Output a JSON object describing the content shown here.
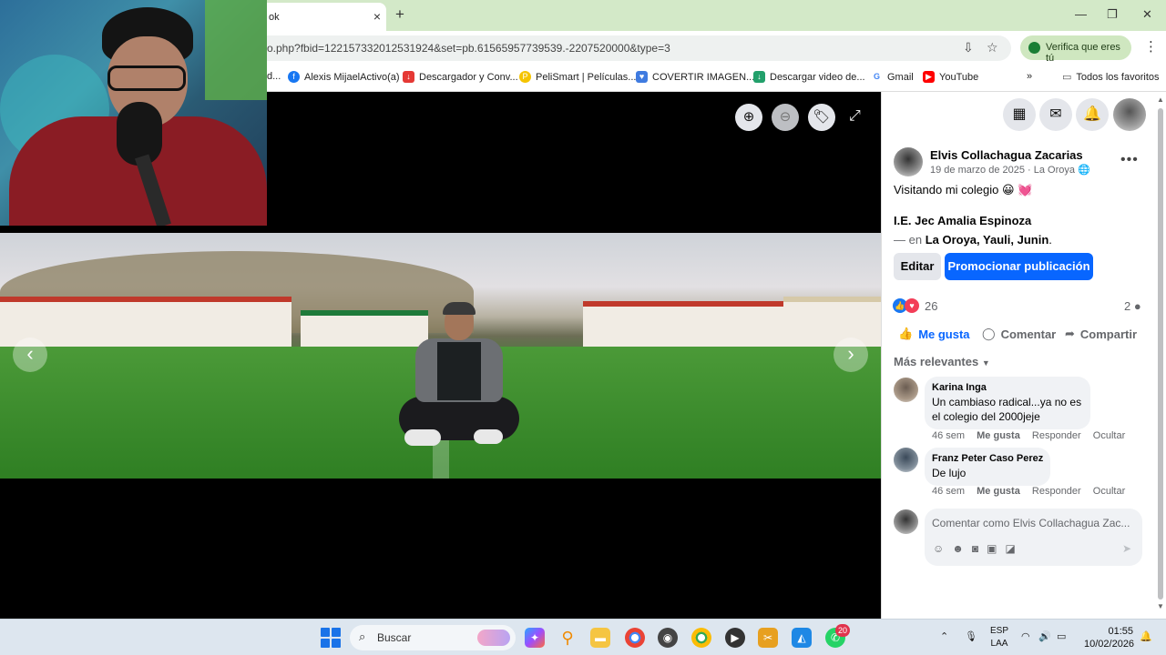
{
  "browser": {
    "tab_title": "ok",
    "tab_close": "×",
    "new_tab": "+",
    "url": "o.php?fbid=122157332012531924&set=pb.61565957739539.-2207520000&type=3",
    "verify_label": "Verifica que eres tú",
    "window_controls": {
      "minimize": "—",
      "restore": "❐",
      "close": "✕"
    },
    "bookmarks": [
      {
        "label": "d...",
        "icon": "page-icon",
        "color": "#f0b400"
      },
      {
        "label": "Alexis MijaelActivo(a)",
        "icon": "facebook-icon",
        "color": "#1877f2"
      },
      {
        "label": "Descargador y Conv...",
        "icon": "download-icon",
        "color": "#e53935"
      },
      {
        "label": "PeliSmart | Películas...",
        "icon": "pelismart-icon",
        "color": "#f5c400"
      },
      {
        "label": "COVERTIR IMAGEN...",
        "icon": "heart-icon",
        "color": "#3f7be0"
      },
      {
        "label": "Descargar video de...",
        "icon": "download-icon",
        "color": "#22a06b"
      },
      {
        "label": "Gmail",
        "icon": "google-icon",
        "color": "#4285f4"
      },
      {
        "label": "YouTube",
        "icon": "youtube-icon",
        "color": "#ff0000"
      }
    ],
    "bookmarks_overflow": "»",
    "all_bookmarks": "Todos los favoritos"
  },
  "viewer": {
    "zoom_in": "⊕",
    "zoom_out": "⊖",
    "tag": "🏷",
    "expand": "⤢",
    "prev": "‹",
    "next": "›"
  },
  "post": {
    "author": "Elvis Collachagua Zacarias",
    "date": "19 de marzo de 2025",
    "location_short": "La Oroya",
    "text": "Visitando mi colegio 😀 💓",
    "place_name": "I.E. Jec Amalia Espinoza",
    "place_prefix": "— en ",
    "place_location": "La Oroya, Yauli, Junin",
    "place_suffix": ".",
    "edit_label": "Editar",
    "promote_label": "Promocionar publicación",
    "reaction_count": "26",
    "comment_count": "2",
    "like_label": "Me gusta",
    "comment_label": "Comentar",
    "share_label": "Compartir",
    "sort_label": "Más relevantes",
    "comments": [
      {
        "name": "Karina Inga",
        "text": "Un cambiaso radical...ya no es el colegio del 2000jeje",
        "age": "46 sem",
        "like": "Me gusta",
        "reply": "Responder",
        "hide": "Ocultar"
      },
      {
        "name": "Franz Peter Caso Perez",
        "text": "De lujo",
        "age": "46 sem",
        "like": "Me gusta",
        "reply": "Responder",
        "hide": "Ocultar"
      }
    ],
    "composer_placeholder": "Comentar como Elvis Collachagua Zac..."
  },
  "taskbar": {
    "search_label": "Buscar",
    "whatsapp_badge": "20",
    "lang_top": "ESP",
    "lang_bottom": "LAA",
    "time": "01:55",
    "date": "10/02/2026"
  }
}
